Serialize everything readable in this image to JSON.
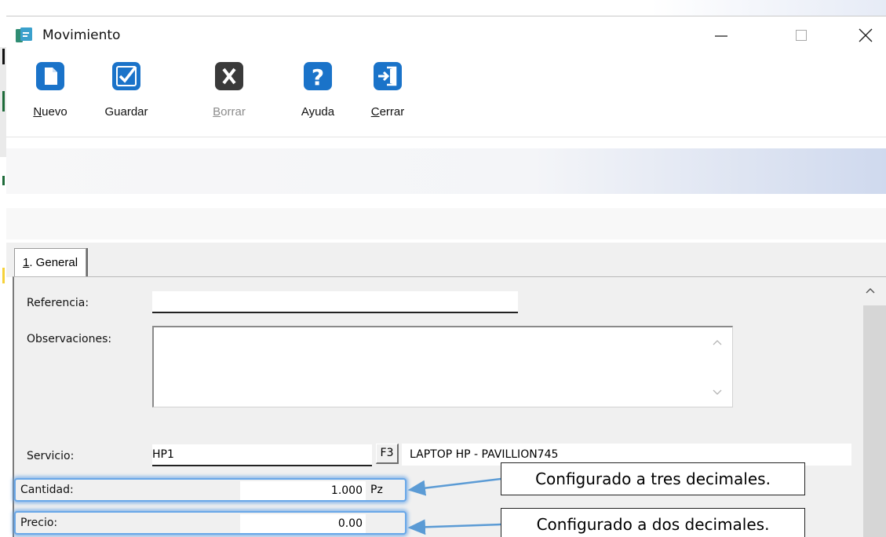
{
  "window": {
    "title": "Movimiento"
  },
  "toolbar": {
    "items": [
      {
        "label_u": "N",
        "label_rest": "uevo",
        "icon": "new-document-icon",
        "enabled": true
      },
      {
        "label_u": "",
        "label_rest": "Guardar",
        "icon": "checkmark-icon",
        "enabled": true
      },
      {
        "label_u": "B",
        "label_rest": "orrar",
        "icon": "delete-x-icon",
        "enabled": false
      },
      {
        "label_u": "",
        "label_rest": "Ayuda",
        "icon": "help-question-icon",
        "enabled": true
      },
      {
        "label_u": "C",
        "label_rest": "errar",
        "icon": "exit-door-icon",
        "enabled": true
      }
    ]
  },
  "tabs": [
    {
      "label_u": "1",
      "label_rest": ". General"
    }
  ],
  "form": {
    "referencia_label": "Referencia:",
    "referencia_value": "",
    "observaciones_label": "Observaciones:",
    "observaciones_value": "",
    "servicio_label": "Servicio:",
    "servicio_value": "HP1",
    "lookup_button": "F3",
    "servicio_desc": "LAPTOP HP - PAVILLION745",
    "cantidad_label": "Cantidad:",
    "cantidad_value": "1.000",
    "cantidad_unit": "Pz",
    "precio_label": "Precio:",
    "precio_value": "0.00"
  },
  "annotations": {
    "cantidad_note": "Configurado a tres decimales.",
    "precio_note": "Configurado a dos decimales."
  },
  "colors": {
    "toolbar_icon_blue": "#1a73c9",
    "toolbar_icon_disabled": "#3a3a3a",
    "highlight_glow": "#6aa8e8",
    "arrow": "#5b9bd5"
  }
}
